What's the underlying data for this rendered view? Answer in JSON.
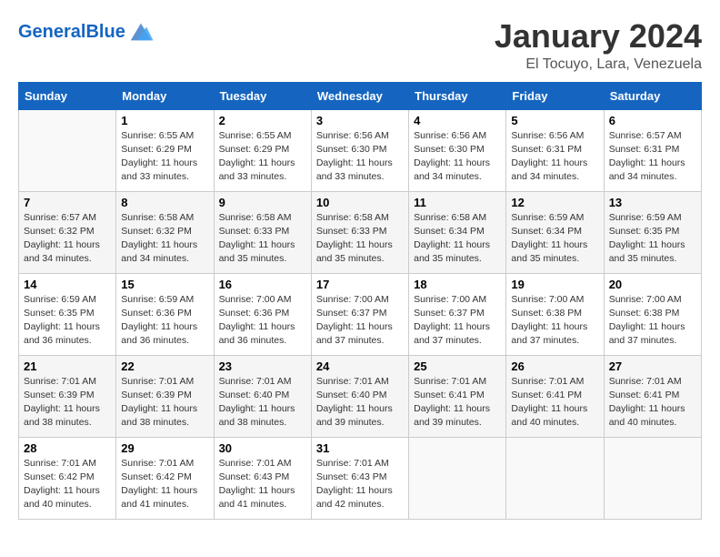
{
  "header": {
    "logo_general": "General",
    "logo_blue": "Blue",
    "month_title": "January 2024",
    "subtitle": "El Tocuyo, Lara, Venezuela"
  },
  "days_of_week": [
    "Sunday",
    "Monday",
    "Tuesday",
    "Wednesday",
    "Thursday",
    "Friday",
    "Saturday"
  ],
  "weeks": [
    [
      {
        "num": "",
        "empty": true
      },
      {
        "num": "1",
        "sunrise": "6:55 AM",
        "sunset": "6:29 PM",
        "daylight": "11 hours and 33 minutes."
      },
      {
        "num": "2",
        "sunrise": "6:55 AM",
        "sunset": "6:29 PM",
        "daylight": "11 hours and 33 minutes."
      },
      {
        "num": "3",
        "sunrise": "6:56 AM",
        "sunset": "6:30 PM",
        "daylight": "11 hours and 33 minutes."
      },
      {
        "num": "4",
        "sunrise": "6:56 AM",
        "sunset": "6:30 PM",
        "daylight": "11 hours and 34 minutes."
      },
      {
        "num": "5",
        "sunrise": "6:56 AM",
        "sunset": "6:31 PM",
        "daylight": "11 hours and 34 minutes."
      },
      {
        "num": "6",
        "sunrise": "6:57 AM",
        "sunset": "6:31 PM",
        "daylight": "11 hours and 34 minutes."
      }
    ],
    [
      {
        "num": "7",
        "sunrise": "6:57 AM",
        "sunset": "6:32 PM",
        "daylight": "11 hours and 34 minutes."
      },
      {
        "num": "8",
        "sunrise": "6:58 AM",
        "sunset": "6:32 PM",
        "daylight": "11 hours and 34 minutes."
      },
      {
        "num": "9",
        "sunrise": "6:58 AM",
        "sunset": "6:33 PM",
        "daylight": "11 hours and 35 minutes."
      },
      {
        "num": "10",
        "sunrise": "6:58 AM",
        "sunset": "6:33 PM",
        "daylight": "11 hours and 35 minutes."
      },
      {
        "num": "11",
        "sunrise": "6:58 AM",
        "sunset": "6:34 PM",
        "daylight": "11 hours and 35 minutes."
      },
      {
        "num": "12",
        "sunrise": "6:59 AM",
        "sunset": "6:34 PM",
        "daylight": "11 hours and 35 minutes."
      },
      {
        "num": "13",
        "sunrise": "6:59 AM",
        "sunset": "6:35 PM",
        "daylight": "11 hours and 35 minutes."
      }
    ],
    [
      {
        "num": "14",
        "sunrise": "6:59 AM",
        "sunset": "6:35 PM",
        "daylight": "11 hours and 36 minutes."
      },
      {
        "num": "15",
        "sunrise": "6:59 AM",
        "sunset": "6:36 PM",
        "daylight": "11 hours and 36 minutes."
      },
      {
        "num": "16",
        "sunrise": "7:00 AM",
        "sunset": "6:36 PM",
        "daylight": "11 hours and 36 minutes."
      },
      {
        "num": "17",
        "sunrise": "7:00 AM",
        "sunset": "6:37 PM",
        "daylight": "11 hours and 37 minutes."
      },
      {
        "num": "18",
        "sunrise": "7:00 AM",
        "sunset": "6:37 PM",
        "daylight": "11 hours and 37 minutes."
      },
      {
        "num": "19",
        "sunrise": "7:00 AM",
        "sunset": "6:38 PM",
        "daylight": "11 hours and 37 minutes."
      },
      {
        "num": "20",
        "sunrise": "7:00 AM",
        "sunset": "6:38 PM",
        "daylight": "11 hours and 37 minutes."
      }
    ],
    [
      {
        "num": "21",
        "sunrise": "7:01 AM",
        "sunset": "6:39 PM",
        "daylight": "11 hours and 38 minutes."
      },
      {
        "num": "22",
        "sunrise": "7:01 AM",
        "sunset": "6:39 PM",
        "daylight": "11 hours and 38 minutes."
      },
      {
        "num": "23",
        "sunrise": "7:01 AM",
        "sunset": "6:40 PM",
        "daylight": "11 hours and 38 minutes."
      },
      {
        "num": "24",
        "sunrise": "7:01 AM",
        "sunset": "6:40 PM",
        "daylight": "11 hours and 39 minutes."
      },
      {
        "num": "25",
        "sunrise": "7:01 AM",
        "sunset": "6:41 PM",
        "daylight": "11 hours and 39 minutes."
      },
      {
        "num": "26",
        "sunrise": "7:01 AM",
        "sunset": "6:41 PM",
        "daylight": "11 hours and 40 minutes."
      },
      {
        "num": "27",
        "sunrise": "7:01 AM",
        "sunset": "6:41 PM",
        "daylight": "11 hours and 40 minutes."
      }
    ],
    [
      {
        "num": "28",
        "sunrise": "7:01 AM",
        "sunset": "6:42 PM",
        "daylight": "11 hours and 40 minutes."
      },
      {
        "num": "29",
        "sunrise": "7:01 AM",
        "sunset": "6:42 PM",
        "daylight": "11 hours and 41 minutes."
      },
      {
        "num": "30",
        "sunrise": "7:01 AM",
        "sunset": "6:43 PM",
        "daylight": "11 hours and 41 minutes."
      },
      {
        "num": "31",
        "sunrise": "7:01 AM",
        "sunset": "6:43 PM",
        "daylight": "11 hours and 42 minutes."
      },
      {
        "num": "",
        "empty": true
      },
      {
        "num": "",
        "empty": true
      },
      {
        "num": "",
        "empty": true
      }
    ]
  ]
}
